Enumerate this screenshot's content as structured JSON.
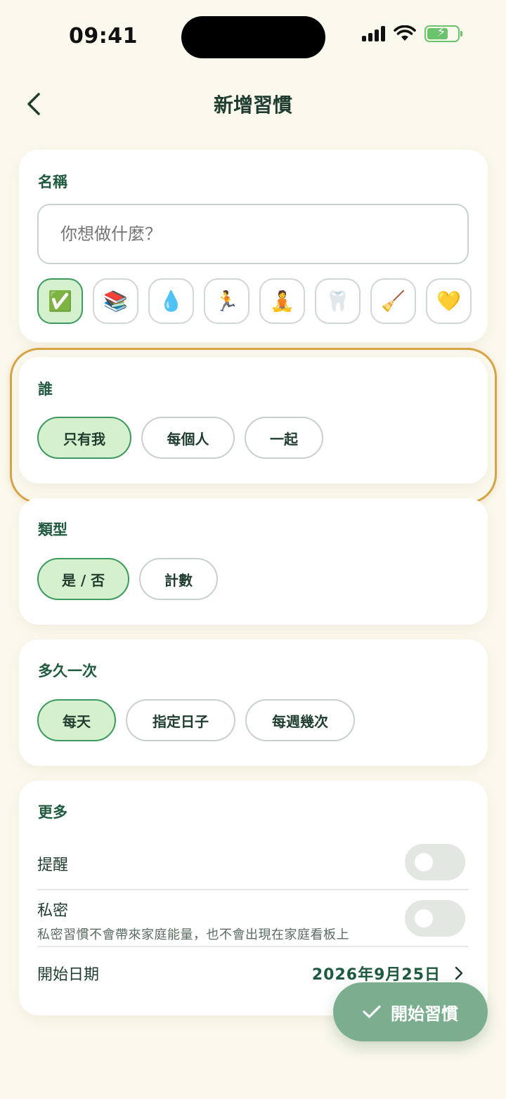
{
  "status_bar": {
    "time": "09:41"
  },
  "header": {
    "title": "新增習慣",
    "back_icon": "chevron-left-icon"
  },
  "name_card": {
    "label": "名稱",
    "placeholder": "你想做什麼？",
    "emojis": [
      "✅",
      "📚",
      "💧",
      "🏃",
      "🧘",
      "🦷",
      "🧹",
      "💛"
    ],
    "selected_index": 0
  },
  "who_card": {
    "label": "誰",
    "options": [
      "只有我",
      "每個人",
      "一起"
    ],
    "selected_index": 0
  },
  "type_card": {
    "label": "類型",
    "options": [
      "是 / 否",
      "計數"
    ],
    "selected_index": 0
  },
  "frequency_card": {
    "label": "多久一次",
    "options": [
      "每天",
      "指定日子",
      "每週幾次"
    ],
    "selected_index": 0
  },
  "more_card": {
    "label": "更多",
    "reminder_label": "提醒",
    "reminder_on": false,
    "private_label": "私密",
    "private_desc": "私密習慣不會帶來家庭能量，也不會出現在家庭看板上",
    "private_on": false,
    "start_date_label": "開始日期",
    "start_date_value": "2026年9月25日"
  },
  "fab": {
    "label": "開始習慣",
    "icon": "check-icon"
  },
  "colors": {
    "background": "#fbf8ee",
    "accent_green": "#1f5a3e",
    "selected_chip": "#d4f0cd",
    "focus_ring": "#d6a446",
    "fab": "#7bae8f"
  }
}
